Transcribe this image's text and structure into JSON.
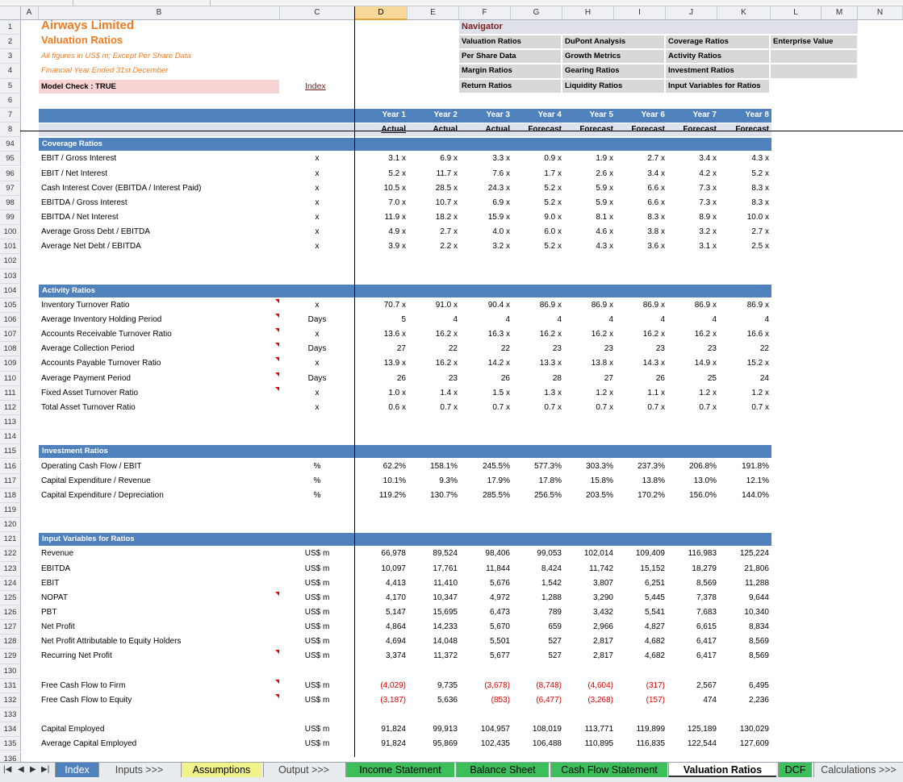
{
  "sheet": {
    "company": "Airways Limited",
    "title": "Valuation Ratios",
    "note1": "All figures in US$ m; Except Per Share Data",
    "note2": "Financial Year Ended 31st December",
    "model_check": "Model Check : TRUE",
    "index_link": "Index"
  },
  "columns": [
    "A",
    "B",
    "C",
    "D",
    "E",
    "F",
    "G",
    "H",
    "I",
    "J",
    "K",
    "L",
    "M",
    "N"
  ],
  "selected_column": "D",
  "navigator": {
    "title": "Navigator",
    "buttons": [
      "Valuation Ratios",
      "DuPont Analysis",
      "Coverage Ratios",
      "Enterprise Value",
      "Per Share Data",
      "Growth Metrics",
      "Activity Ratios",
      "Margin Ratios",
      "Gearing Ratios",
      "Investment Ratios",
      "Return Ratios",
      "Liquidity Ratios",
      "Input Variables for Ratios"
    ]
  },
  "years": [
    "Year 1",
    "Year 2",
    "Year 3",
    "Year 4",
    "Year 5",
    "Year 6",
    "Year 7",
    "Year 8"
  ],
  "year_types": [
    "Actual",
    "Actual",
    "Actual",
    "Forecast",
    "Forecast",
    "Forecast",
    "Forecast",
    "Forecast"
  ],
  "rows": [
    {
      "n": "1",
      "t": "blank"
    },
    {
      "n": "2",
      "t": "blank"
    },
    {
      "n": "3",
      "t": "blank"
    },
    {
      "n": "4",
      "t": "blank"
    },
    {
      "n": "5",
      "t": "blank"
    },
    {
      "n": "6",
      "t": "blank"
    },
    {
      "n": "7",
      "t": "blank"
    },
    {
      "n": "8",
      "t": "blank"
    },
    {
      "n": "94",
      "t": "sec",
      "label": "Coverage Ratios"
    },
    {
      "n": "95",
      "label": "EBIT / Gross Interest",
      "unit": "x",
      "v": [
        "3.1 x",
        "6.9 x",
        "3.3 x",
        "0.9 x",
        "1.9 x",
        "2.7 x",
        "3.4 x",
        "4.3 x"
      ]
    },
    {
      "n": "96",
      "label": "EBIT / Net Interest",
      "unit": "x",
      "v": [
        "5.2 x",
        "11.7 x",
        "7.6 x",
        "1.7 x",
        "2.6 x",
        "3.4 x",
        "4.2 x",
        "5.2 x"
      ]
    },
    {
      "n": "97",
      "label": "Cash Interest Cover (EBITDA / Interest Paid)",
      "unit": "x",
      "v": [
        "10.5 x",
        "28.5 x",
        "24.3 x",
        "5.2 x",
        "5.9 x",
        "6.6 x",
        "7.3 x",
        "8.3 x"
      ]
    },
    {
      "n": "98",
      "label": "EBITDA / Gross Interest",
      "unit": "x",
      "v": [
        "7.0 x",
        "10.7 x",
        "6.9 x",
        "5.2 x",
        "5.9 x",
        "6.6 x",
        "7.3 x",
        "8.3 x"
      ]
    },
    {
      "n": "99",
      "label": "EBITDA / Net Interest",
      "unit": "x",
      "v": [
        "11.9 x",
        "18.2 x",
        "15.9 x",
        "9.0 x",
        "8.1 x",
        "8.3 x",
        "8.9 x",
        "10.0 x"
      ]
    },
    {
      "n": "100",
      "label": "Average Gross Debt / EBITDA",
      "unit": "x",
      "v": [
        "4.9 x",
        "2.7 x",
        "4.0 x",
        "6.0 x",
        "4.6 x",
        "3.8 x",
        "3.2 x",
        "2.7 x"
      ]
    },
    {
      "n": "101",
      "label": "Average Net Debt / EBITDA",
      "unit": "x",
      "v": [
        "3.9 x",
        "2.2 x",
        "3.2 x",
        "5.2 x",
        "4.3 x",
        "3.6 x",
        "3.1 x",
        "2.5 x"
      ]
    },
    {
      "n": "102",
      "t": "blank"
    },
    {
      "n": "103",
      "t": "blank"
    },
    {
      "n": "104",
      "t": "sec",
      "label": "Activity Ratios"
    },
    {
      "n": "105",
      "label": "Inventory Turnover Ratio",
      "unit": "x",
      "flag": true,
      "v": [
        "70.7 x",
        "91.0 x",
        "90.4 x",
        "86.9 x",
        "86.9 x",
        "86.9 x",
        "86.9 x",
        "86.9 x"
      ]
    },
    {
      "n": "106",
      "label": "Average Inventory Holding Period",
      "unit": "Days",
      "flag": true,
      "v": [
        "5",
        "4",
        "4",
        "4",
        "4",
        "4",
        "4",
        "4"
      ]
    },
    {
      "n": "107",
      "label": "Accounts Receivable Turnover Ratio",
      "unit": "x",
      "flag": true,
      "v": [
        "13.6 x",
        "16.2 x",
        "16.3 x",
        "16.2 x",
        "16.2 x",
        "16.2 x",
        "16.2 x",
        "16.6 x"
      ]
    },
    {
      "n": "108",
      "label": "Average Collection Period",
      "unit": "Days",
      "flag": true,
      "v": [
        "27",
        "22",
        "22",
        "23",
        "23",
        "23",
        "23",
        "22"
      ]
    },
    {
      "n": "109",
      "label": "Accounts Payable Turnover Ratio",
      "unit": "x",
      "flag": true,
      "v": [
        "13.9 x",
        "16.2 x",
        "14.2 x",
        "13.3 x",
        "13.8 x",
        "14.3 x",
        "14.9 x",
        "15.2 x"
      ]
    },
    {
      "n": "110",
      "label": "Average Payment Period",
      "unit": "Days",
      "flag": true,
      "v": [
        "26",
        "23",
        "26",
        "28",
        "27",
        "26",
        "25",
        "24"
      ]
    },
    {
      "n": "111",
      "label": "Fixed Asset Turnover Ratio",
      "unit": "x",
      "flag": true,
      "v": [
        "1.0 x",
        "1.4 x",
        "1.5 x",
        "1.3 x",
        "1.2 x",
        "1.1 x",
        "1.2 x",
        "1.2 x"
      ]
    },
    {
      "n": "112",
      "label": "Total Asset Turnover Ratio",
      "unit": "x",
      "v": [
        "0.6 x",
        "0.7 x",
        "0.7 x",
        "0.7 x",
        "0.7 x",
        "0.7 x",
        "0.7 x",
        "0.7 x"
      ]
    },
    {
      "n": "113",
      "t": "blank"
    },
    {
      "n": "114",
      "t": "blank"
    },
    {
      "n": "115",
      "t": "sec",
      "label": "Investment Ratios"
    },
    {
      "n": "116",
      "label": "Operating Cash Flow / EBIT",
      "unit": "%",
      "v": [
        "62.2%",
        "158.1%",
        "245.5%",
        "577.3%",
        "303.3%",
        "237.3%",
        "206.8%",
        "191.8%"
      ]
    },
    {
      "n": "117",
      "label": "Capital Expenditure / Revenue",
      "unit": "%",
      "v": [
        "10.1%",
        "9.3%",
        "17.9%",
        "17.8%",
        "15.8%",
        "13.8%",
        "13.0%",
        "12.1%"
      ]
    },
    {
      "n": "118",
      "label": "Capital Expenditure / Depreciation",
      "unit": "%",
      "v": [
        "119.2%",
        "130.7%",
        "285.5%",
        "256.5%",
        "203.5%",
        "170.2%",
        "156.0%",
        "144.0%"
      ]
    },
    {
      "n": "119",
      "t": "blank"
    },
    {
      "n": "120",
      "t": "blank"
    },
    {
      "n": "121",
      "t": "sec",
      "label": "Input Variables for Ratios"
    },
    {
      "n": "122",
      "label": "Revenue",
      "unit": "US$ m",
      "v": [
        "66,978",
        "89,524",
        "98,406",
        "99,053",
        "102,014",
        "109,409",
        "116,983",
        "125,224"
      ]
    },
    {
      "n": "123",
      "label": "EBITDA",
      "unit": "US$ m",
      "v": [
        "10,097",
        "17,761",
        "11,844",
        "8,424",
        "11,742",
        "15,152",
        "18,279",
        "21,806"
      ]
    },
    {
      "n": "124",
      "label": "EBIT",
      "unit": "US$ m",
      "v": [
        "4,413",
        "11,410",
        "5,676",
        "1,542",
        "3,807",
        "6,251",
        "8,569",
        "11,288"
      ]
    },
    {
      "n": "125",
      "label": "NOPAT",
      "unit": "US$ m",
      "flag": true,
      "v": [
        "4,170",
        "10,347",
        "4,972",
        "1,288",
        "3,290",
        "5,445",
        "7,378",
        "9,644"
      ]
    },
    {
      "n": "126",
      "label": "PBT",
      "unit": "US$ m",
      "v": [
        "5,147",
        "15,695",
        "6,473",
        "789",
        "3,432",
        "5,541",
        "7,683",
        "10,340"
      ]
    },
    {
      "n": "127",
      "label": "Net Profit",
      "unit": "US$ m",
      "v": [
        "4,864",
        "14,233",
        "5,670",
        "659",
        "2,966",
        "4,827",
        "6,615",
        "8,834"
      ]
    },
    {
      "n": "128",
      "label": "Net Profit Attributable to Equity Holders",
      "unit": "US$ m",
      "v": [
        "4,694",
        "14,048",
        "5,501",
        "527",
        "2,817",
        "4,682",
        "6,417",
        "8,569"
      ]
    },
    {
      "n": "129",
      "label": "Recurring Net Profit",
      "unit": "US$ m",
      "flag": true,
      "v": [
        "3,374",
        "11,372",
        "5,677",
        "527",
        "2,817",
        "4,682",
        "6,417",
        "8,569"
      ]
    },
    {
      "n": "130",
      "t": "blank"
    },
    {
      "n": "131",
      "label": "Free Cash Flow to Firm",
      "unit": "US$ m",
      "flag": true,
      "v": [
        "(4,029)",
        "9,735",
        "(3,678)",
        "(8,748)",
        "(4,604)",
        "(317)",
        "2,567",
        "6,495"
      ]
    },
    {
      "n": "132",
      "label": "Free Cash Flow to Equity",
      "unit": "US$ m",
      "flag": true,
      "v": [
        "(3,187)",
        "5,636",
        "(853)",
        "(6,477)",
        "(3,268)",
        "(157)",
        "474",
        "2,236"
      ]
    },
    {
      "n": "133",
      "t": "blank"
    },
    {
      "n": "134",
      "label": "Capital Employed",
      "unit": "US$ m",
      "v": [
        "91,824",
        "99,913",
        "104,957",
        "108,019",
        "113,771",
        "119,899",
        "125,189",
        "130,029"
      ]
    },
    {
      "n": "135",
      "label": "Average Capital Employed",
      "unit": "US$ m",
      "v": [
        "91,824",
        "95,869",
        "102,435",
        "106,488",
        "110,895",
        "116,835",
        "122,544",
        "127,609"
      ]
    },
    {
      "n": "136",
      "t": "blank"
    }
  ],
  "tabs": [
    {
      "label": "Index",
      "color": "#4f81bd",
      "text": "#ffffff"
    },
    {
      "label": "Inputs >>>",
      "color": "#e9ecef",
      "text": "#444444"
    },
    {
      "label": "Assumptions",
      "color": "#f2f28a",
      "text": "#000000"
    },
    {
      "label": "Output >>>",
      "color": "#e9ecef",
      "text": "#444444"
    },
    {
      "label": "Income Statement",
      "color": "#3cbf5a",
      "text": "#000000"
    },
    {
      "label": "Balance Sheet",
      "color": "#3cbf5a",
      "text": "#000000"
    },
    {
      "label": "Cash Flow Statement",
      "color": "#3cbf5a",
      "text": "#000000"
    },
    {
      "label": "Valuation Ratios",
      "color": "#ffffff",
      "text": "#000000"
    },
    {
      "label": "DCF",
      "color": "#3cbf5a",
      "text": "#000000"
    },
    {
      "label": "Calculations >>>",
      "color": "#e9ecef",
      "text": "#444444"
    }
  ],
  "tab_nav": [
    "first-sheet-icon",
    "prev-sheet-icon",
    "next-sheet-icon",
    "last-sheet-icon"
  ],
  "active_tab": "Valuation Ratios",
  "colors": {
    "header_blue": "#4f81bd",
    "title_orange": "#f07c22",
    "negative_red": "#e00000",
    "model_check_pink": "#f7d3d3",
    "navigator_gray": "#d8d8d8"
  }
}
